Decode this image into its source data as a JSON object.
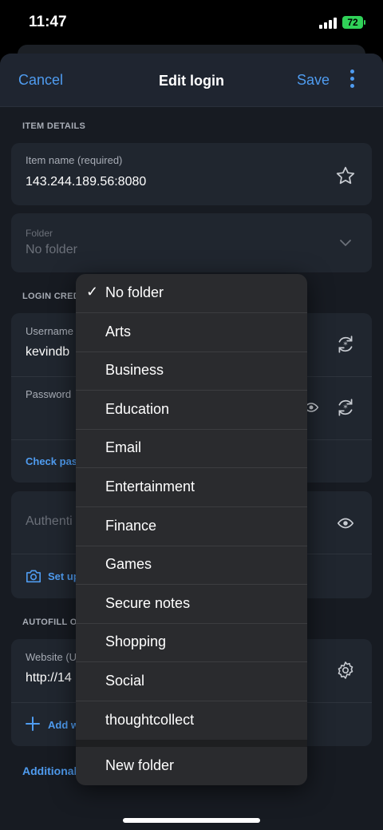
{
  "status": {
    "time": "11:47",
    "battery": "72"
  },
  "nav": {
    "cancel": "Cancel",
    "title": "Edit login",
    "save": "Save"
  },
  "item_details": {
    "section": "ITEM DETAILS",
    "name_label": "Item name (required)",
    "name_value": "143.244.189.56:8080",
    "folder_label": "Folder",
    "folder_value": "No folder"
  },
  "login": {
    "section": "LOGIN CRED",
    "username_label": "Username",
    "username_value": "kevindb",
    "password_label": "Password",
    "check_link": "Check pas",
    "auth_placeholder": "Authenti",
    "setup_link": "Set up"
  },
  "autofill": {
    "section": "AUTOFILL O",
    "website_label": "Website (U",
    "website_value": "http://14",
    "add_link": "Add w",
    "additional": "Additional"
  },
  "dropdown": {
    "items": [
      "No folder",
      "Arts",
      "Business",
      "Education",
      "Email",
      "Entertainment",
      "Finance",
      "Games",
      "Secure notes",
      "Shopping",
      "Social",
      "thoughtcollect"
    ],
    "checked_index": 0,
    "new_folder": "New folder"
  },
  "colors": {
    "accent": "#4f9cf0",
    "background": "#171b22",
    "card": "#20262f",
    "menu": "#2a2b2e"
  }
}
